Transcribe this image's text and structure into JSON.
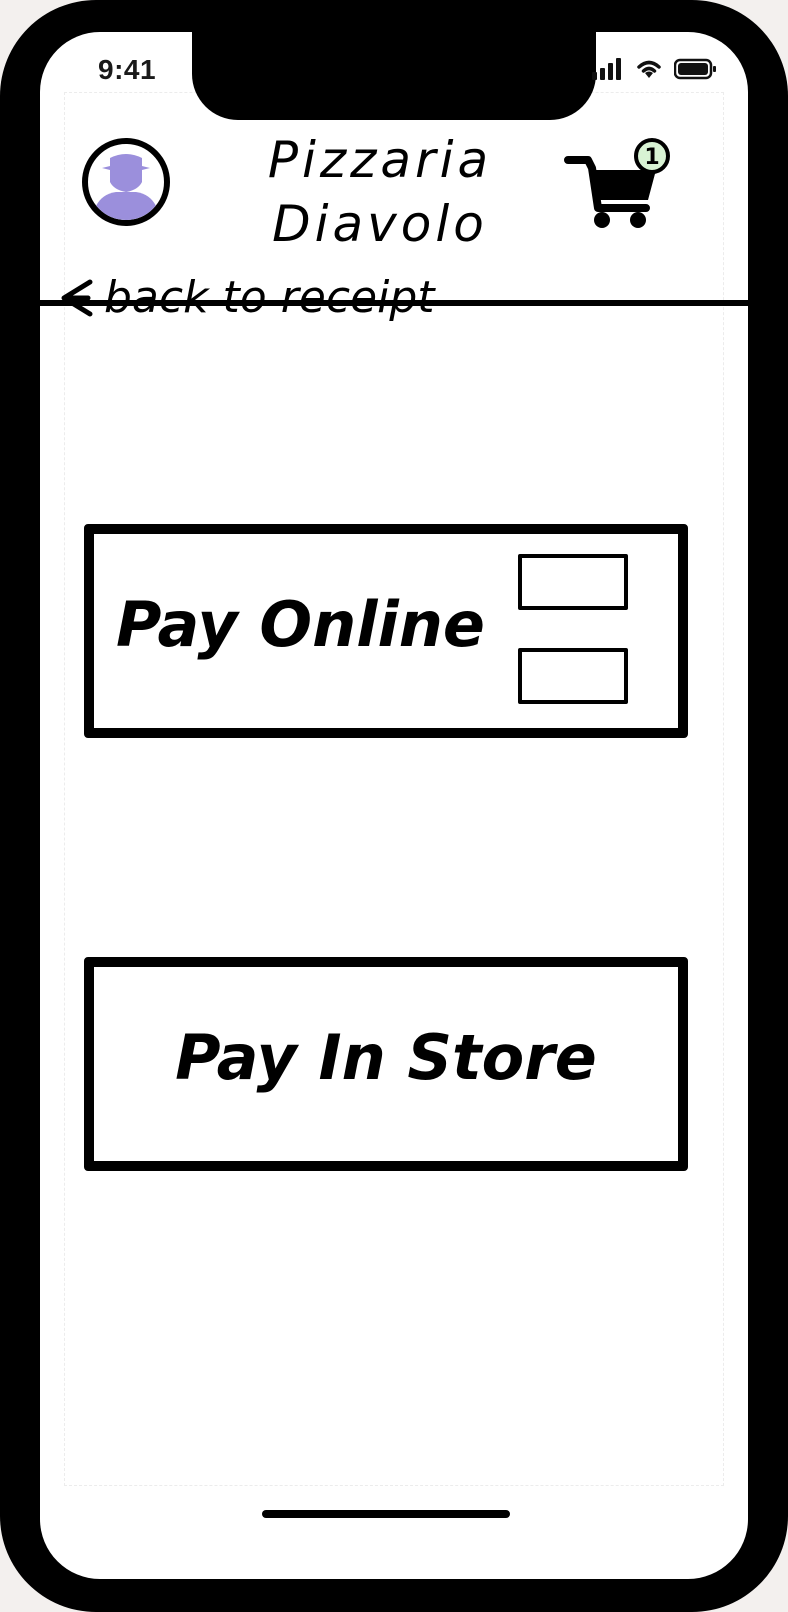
{
  "status_bar": {
    "time": "9:41"
  },
  "header": {
    "brand_line1": "Pizzaria",
    "brand_line2": "Diavolo",
    "cart_count": "1",
    "icons": {
      "avatar": "user-avatar-icon",
      "cart": "shopping-cart-icon"
    },
    "colors": {
      "avatar_fill": "#9b8fdc",
      "badge_fill": "#d8f3d4"
    }
  },
  "nav": {
    "back_label": "back to receipt"
  },
  "payment_options": {
    "online_label": "Pay Online",
    "store_label": "Pay In Store"
  }
}
